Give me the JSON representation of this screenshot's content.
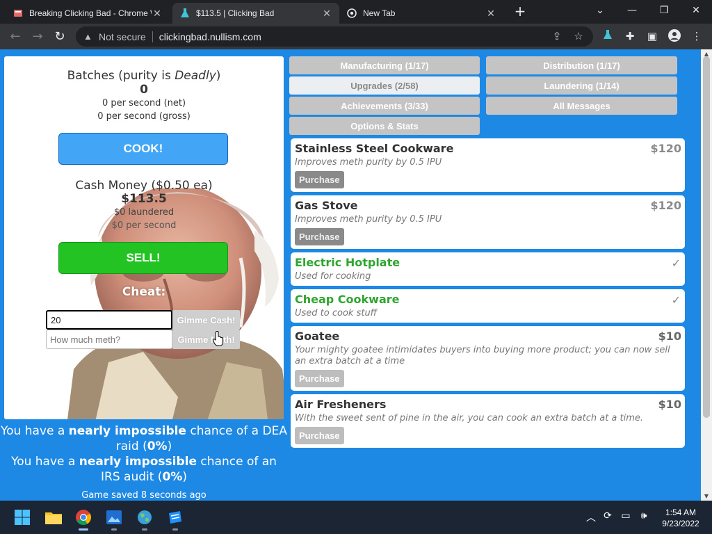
{
  "browser": {
    "tabs": [
      {
        "title": "Breaking Clicking Bad - Chrome W",
        "active": false
      },
      {
        "title": "$113.5 | Clicking Bad",
        "active": true
      },
      {
        "title": "New Tab",
        "active": false
      }
    ],
    "security_label": "Not secure",
    "url": "clickingbad.nullism.com"
  },
  "game": {
    "batches": {
      "prefix": "Batches (purity is ",
      "purity": "Deadly",
      "suffix": ")",
      "count": "0",
      "net": "0 per second (net)",
      "gross": "0 per second (gross)"
    },
    "cook_label": "COOK!",
    "cash": {
      "label": "Cash Money ($0.50 ea)",
      "amount": "$113.5",
      "laundered": "$0 laundered",
      "per_second": "$0 per second"
    },
    "sell_label": "SELL!",
    "cheat": {
      "title": "Cheat:",
      "cash_input_value": "20",
      "cash_button": "Gimme Cash!",
      "meth_placeholder": "How much meth?",
      "meth_button": "Gimme Meth!"
    },
    "risk": {
      "dea": {
        "p1": "You have a ",
        "level": "nearly impossible",
        "p2": " chance of a DEA raid (",
        "pct": "0%",
        "p3": ")"
      },
      "irs": {
        "p1": "You have a ",
        "level": "nearly impossible",
        "p2": " chance of an IRS audit (",
        "pct": "0%",
        "p3": ")"
      }
    },
    "saved_status": "Game saved 8 seconds ago"
  },
  "nav_tabs": [
    {
      "label": "Manufacturing (1/17)",
      "selected": false
    },
    {
      "label": "Distribution (1/17)",
      "selected": false
    },
    {
      "label": "Upgrades (2/58)",
      "selected": true
    },
    {
      "label": "Laundering (1/14)",
      "selected": false
    },
    {
      "label": "Achievements (3/33)",
      "selected": false
    },
    {
      "label": "All Messages",
      "selected": false
    },
    {
      "label": "Options & Stats",
      "selected": false
    }
  ],
  "upgrades": [
    {
      "name": "Stainless Steel Cookware",
      "price": "$120",
      "desc": "Improves meth purity by 0.5 IPU",
      "owned": false,
      "button": "Purchase"
    },
    {
      "name": "Gas Stove",
      "price": "$120",
      "desc": "Improves meth purity by 0.5 IPU",
      "owned": false,
      "button": "Purchase"
    },
    {
      "name": "Electric Hotplate",
      "price": "",
      "desc": "Used for cooking",
      "owned": true,
      "button": ""
    },
    {
      "name": "Cheap Cookware",
      "price": "",
      "desc": "Used to cook stuff",
      "owned": true,
      "button": ""
    },
    {
      "name": "Goatee",
      "price": "$10",
      "desc": "Your mighty goatee intimidates buyers into buying more product; you can now sell an extra batch at a time",
      "owned": false,
      "button": "Purchase"
    },
    {
      "name": "Air Fresheners",
      "price": "$10",
      "desc": "With the sweet sent of pine in the air, you can cook an extra batch at a time.",
      "owned": false,
      "button": "Purchase"
    }
  ],
  "taskbar": {
    "time": "1:54 AM",
    "date": "9/23/2022"
  },
  "colors": {
    "page_bg": "#1e88e5",
    "cook_button": "#42a5f5",
    "sell_button": "#22c322",
    "owned_text": "#2ea52e"
  }
}
